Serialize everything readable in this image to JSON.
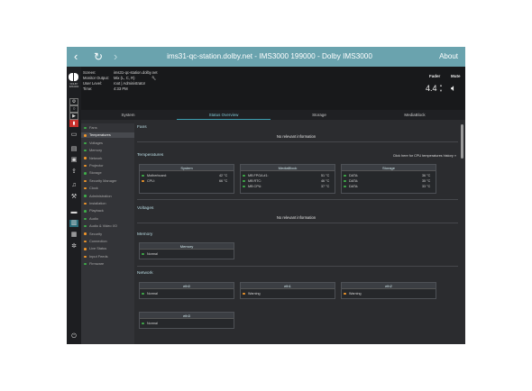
{
  "colors": {
    "ok": "#3fae49",
    "warn": "#f0962a",
    "accent": "#6aa3ae",
    "panel_bg": "#2b2c2f"
  },
  "nav": {
    "back_icon": "chevron-left-icon",
    "reload_icon": "reload-icon",
    "forward_icon": "chevron-right-icon",
    "title": "ims31-qc-station.dolby.net - IMS3000 199000 - Dolby IMS3000",
    "about_label": "About"
  },
  "iconbar": {
    "logo_text": "DOLBY IMS3000",
    "icons": [
      "settings-icon",
      "gear-icon",
      "playback-icon",
      "cpl-icon",
      "screen-icon",
      "library-icon",
      "storage-icon",
      "upload-icon",
      "music-icon",
      "wrench-icon",
      "monitor-icon",
      "status-icon",
      "logs-icon",
      "settings-gear-icon",
      "power-icon"
    ]
  },
  "device": {
    "rows": [
      {
        "key": "Screen:",
        "value": "ims31-qc-station.dolby.net"
      },
      {
        "key": "Monitor Output:",
        "value": "Mix (L, C, R)"
      },
      {
        "key": "User Level:",
        "value": "root | Administrator"
      },
      {
        "key": "Time:",
        "value": "4:33 PM"
      }
    ],
    "fader_label": "Fader",
    "fader_value": "4.4",
    "mute_label": "Mute"
  },
  "tabs": [
    {
      "label": "System"
    },
    {
      "label": "Status Overview"
    },
    {
      "label": "Storage"
    },
    {
      "label": "MediaBlock"
    }
  ],
  "sidebar": {
    "items": [
      {
        "label": "Fans",
        "status": "ok"
      },
      {
        "label": "Temperatures",
        "status": "warn"
      },
      {
        "label": "Voltages",
        "status": "ok"
      },
      {
        "label": "Memory",
        "status": "ok"
      },
      {
        "label": "Network",
        "status": "warn"
      },
      {
        "label": "Projector",
        "status": "warn"
      },
      {
        "label": "Storage",
        "status": "ok"
      },
      {
        "label": "Security Manager",
        "status": "warn"
      },
      {
        "label": "Clock",
        "status": "warn"
      },
      {
        "label": "Administration",
        "status": "ok"
      },
      {
        "label": "Installation",
        "status": "warn"
      },
      {
        "label": "Playback",
        "status": "ok"
      },
      {
        "label": "Audio",
        "status": "ok"
      },
      {
        "label": "Audio & Video I/O",
        "status": "ok"
      },
      {
        "label": "Security",
        "status": "warn"
      },
      {
        "label": "Connection",
        "status": "warn"
      },
      {
        "label": "Live Status",
        "status": "warn"
      },
      {
        "label": "Input Feeds",
        "status": "warn"
      },
      {
        "label": "Firmware",
        "status": "ok"
      }
    ]
  },
  "sections": {
    "fans": {
      "title": "Fans",
      "message": "No relevant information"
    },
    "temperatures": {
      "title": "Temperatures",
      "link": "Click here for CPU temperatures history »",
      "panels": [
        {
          "title": "System",
          "rows": [
            {
              "label": "Motherboard:",
              "value": "42 °C",
              "status": "ok"
            },
            {
              "label": "CPU:",
              "value": "66 °C",
              "status": "warn"
            }
          ]
        },
        {
          "title": "MediaBlock",
          "rows": [
            {
              "label": "MB FPGA #1:",
              "value": "51 °C",
              "status": "ok"
            },
            {
              "label": "MB RTC:",
              "value": "46 °C",
              "status": "ok"
            },
            {
              "label": "MB CPU:",
              "value": "37 °C",
              "status": "ok"
            }
          ]
        },
        {
          "title": "Storage",
          "rows": [
            {
              "label": "DATA:",
              "value": "36 °C",
              "status": "ok"
            },
            {
              "label": "DATA:",
              "value": "35 °C",
              "status": "ok"
            },
            {
              "label": "DATA:",
              "value": "33 °C",
              "status": "ok"
            }
          ]
        }
      ]
    },
    "voltages": {
      "title": "Voltages",
      "message": "No relevant information"
    },
    "memory": {
      "title": "Memory",
      "panels": [
        {
          "title": "Memory",
          "rows": [
            {
              "label": "Normal",
              "status": "ok"
            }
          ]
        }
      ]
    },
    "network": {
      "title": "Network",
      "panels": [
        {
          "title": "eth0",
          "rows": [
            {
              "label": "Normal",
              "status": "ok"
            }
          ]
        },
        {
          "title": "eth1",
          "rows": [
            {
              "label": "Warning",
              "status": "warn"
            }
          ]
        },
        {
          "title": "eth2",
          "rows": [
            {
              "label": "Warning",
              "status": "warn"
            }
          ]
        },
        {
          "title": "eth3",
          "rows": [
            {
              "label": "Normal",
              "status": "ok"
            }
          ]
        }
      ]
    }
  }
}
